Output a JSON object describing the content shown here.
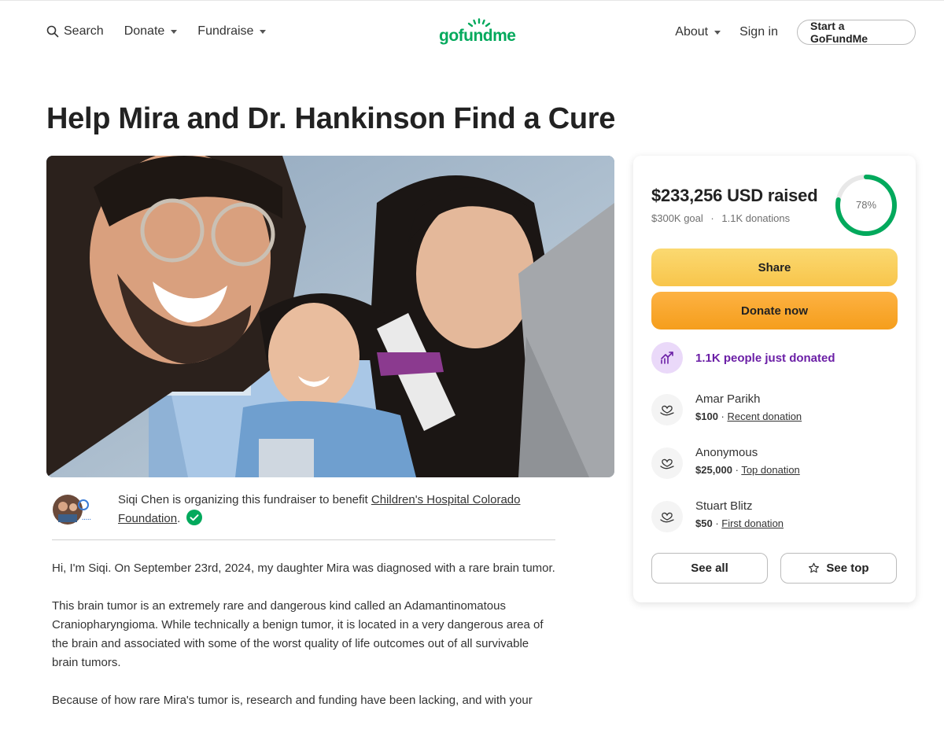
{
  "nav": {
    "search": "Search",
    "donate": "Donate",
    "fundraise": "Fundraise",
    "logo": "gofundme",
    "about": "About",
    "sign_in": "Sign in",
    "start": "Start a GoFundMe"
  },
  "campaign": {
    "title": "Help Mira and Dr. Hankinson Find a Cure"
  },
  "organizer": {
    "text_before": "Siqi Chen is organizing this fundraiser to benefit ",
    "beneficiary": "Children's Hospital Colorado Foundation",
    "text_after": "."
  },
  "story": [
    "Hi, I'm Siqi. On September 23rd, 2024, my daughter Mira was diagnosed with a rare brain tumor.",
    "This brain tumor is an extremely rare and dangerous kind called an Adamantinomatous Craniopharyngioma. While technically a benign tumor, it is located in a very dangerous area of the brain and associated with some of the worst quality of life outcomes out of all survivable brain tumors.",
    "Because of how rare Mira's tumor is, research and funding have been lacking, and with your"
  ],
  "donation": {
    "raised": "$233,256 USD raised",
    "goal": "$300K goal",
    "separator": "·",
    "count": "1.1K donations",
    "percent_label": "78%",
    "percent_value": 0.78,
    "share": "Share",
    "donate_now": "Donate now",
    "just_donated": "1.1K people just donated",
    "donors": [
      {
        "name": "Amar Parikh",
        "amount": "$100",
        "sep": " · ",
        "tag": "Recent donation"
      },
      {
        "name": "Anonymous",
        "amount": "$25,000",
        "sep": " · ",
        "tag": "Top donation"
      },
      {
        "name": "Stuart Blitz",
        "amount": "$50",
        "sep": " · ",
        "tag": "First donation"
      }
    ],
    "see_all": "See all",
    "see_top": "See top"
  },
  "colors": {
    "brand_green": "#02a95c",
    "share_yellow": "#f8c54b",
    "donate_orange": "#f59e1c",
    "purple": "#6b1fa6"
  }
}
